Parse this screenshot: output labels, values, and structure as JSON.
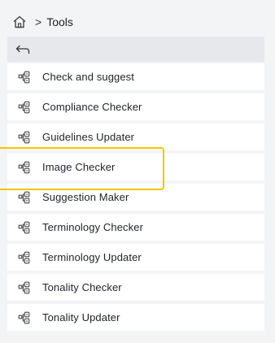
{
  "breadcrumb": {
    "home_icon": "home-icon",
    "separator": ">",
    "current": "Tools"
  },
  "back": {
    "icon": "back-arrow-icon"
  },
  "tools": [
    {
      "label": "Check and suggest",
      "icon": "tool-icon"
    },
    {
      "label": "Compliance Checker",
      "icon": "tool-icon"
    },
    {
      "label": "Guidelines Updater",
      "icon": "tool-icon"
    },
    {
      "label": "Image Checker",
      "icon": "tool-icon",
      "highlighted": true
    },
    {
      "label": "Suggestion Maker",
      "icon": "tool-icon"
    },
    {
      "label": "Terminology Checker",
      "icon": "tool-icon"
    },
    {
      "label": "Terminology Updater",
      "icon": "tool-icon"
    },
    {
      "label": "Tonality Checker",
      "icon": "tool-icon"
    },
    {
      "label": "Tonality Updater",
      "icon": "tool-icon"
    }
  ],
  "colors": {
    "background": "#f3f4f6",
    "item_background": "#ffffff",
    "back_bar": "#e6e8eb",
    "highlight_border": "#f4c400"
  }
}
